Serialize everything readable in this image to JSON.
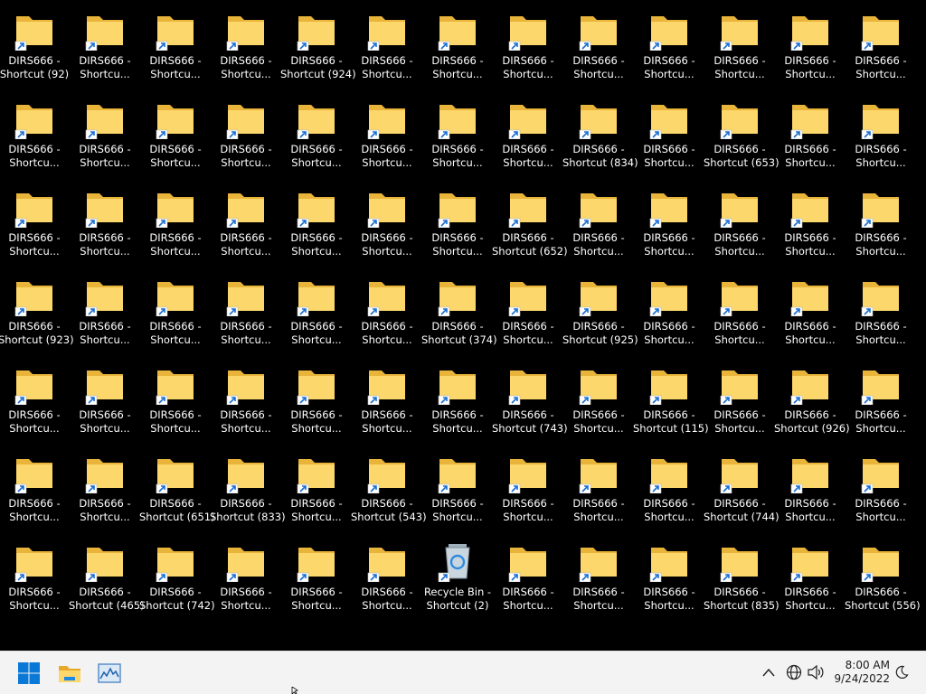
{
  "desktop": {
    "items": [
      [
        "DIRS666 - Shortcut (92)",
        "DIRS666 - Shortcu...",
        "DIRS666 - Shortcu...",
        "DIRS666 - Shortcu...",
        "DIRS666 - Shortcut (924)",
        "DIRS666 - Shortcu...",
        "DIRS666 - Shortcu...",
        "DIRS666 - Shortcu...",
        "DIRS666 - Shortcu...",
        "DIRS666 - Shortcu...",
        "DIRS666 - Shortcu...",
        "DIRS666 - Shortcu...",
        "DIRS666 - Shortcu..."
      ],
      [
        "DIRS666 - Shortcu...",
        "DIRS666 - Shortcu...",
        "DIRS666 - Shortcu...",
        "DIRS666 - Shortcu...",
        "DIRS666 - Shortcu...",
        "DIRS666 - Shortcu...",
        "DIRS666 - Shortcu...",
        "DIRS666 - Shortcu...",
        "DIRS666 - Shortcut (834)",
        "DIRS666 - Shortcu...",
        "DIRS666 - Shortcut (653)",
        "DIRS666 - Shortcu...",
        "DIRS666 - Shortcu..."
      ],
      [
        "DIRS666 - Shortcu...",
        "DIRS666 - Shortcu...",
        "DIRS666 - Shortcu...",
        "DIRS666 - Shortcu...",
        "DIRS666 - Shortcu...",
        "DIRS666 - Shortcu...",
        "DIRS666 - Shortcu...",
        "DIRS666 - Shortcut (652)",
        "DIRS666 - Shortcu...",
        "DIRS666 - Shortcu...",
        "DIRS666 - Shortcu...",
        "DIRS666 - Shortcu...",
        "DIRS666 - Shortcu..."
      ],
      [
        "DIRS666 - Shortcut (923)",
        "DIRS666 - Shortcu...",
        "DIRS666 - Shortcu...",
        "DIRS666 - Shortcu...",
        "DIRS666 - Shortcu...",
        "DIRS666 - Shortcu...",
        "DIRS666 - Shortcut (374)",
        "DIRS666 - Shortcu...",
        "DIRS666 - Shortcut (925)",
        "DIRS666 - Shortcu...",
        "DIRS666 - Shortcu...",
        "DIRS666 - Shortcu...",
        "DIRS666 - Shortcu..."
      ],
      [
        "DIRS666 - Shortcu...",
        "DIRS666 - Shortcu...",
        "DIRS666 - Shortcu...",
        "DIRS666 - Shortcu...",
        "DIRS666 - Shortcu...",
        "DIRS666 - Shortcu...",
        "DIRS666 - Shortcu...",
        "DIRS666 - Shortcut (743)",
        "DIRS666 - Shortcu...",
        "DIRS666 - Shortcut (115)",
        "DIRS666 - Shortcu...",
        "DIRS666 - Shortcut (926)",
        "DIRS666 - Shortcu..."
      ],
      [
        "DIRS666 - Shortcu...",
        "DIRS666 - Shortcu...",
        "DIRS666 - Shortcut (651)",
        "DIRS666 - Shortcut (833)",
        "DIRS666 - Shortcu...",
        "DIRS666 - Shortcut (543)",
        "DIRS666 - Shortcu...",
        "DIRS666 - Shortcu...",
        "DIRS666 - Shortcu...",
        "DIRS666 - Shortcu...",
        "DIRS666 - Shortcut (744)",
        "DIRS666 - Shortcu...",
        "DIRS666 - Shortcu..."
      ],
      [
        "DIRS666 - Shortcu...",
        "DIRS666 - Shortcut (465)",
        "DIRS666 - Shortcut (742)",
        "DIRS666 - Shortcu...",
        "DIRS666 - Shortcu...",
        "DIRS666 - Shortcu...",
        "Recycle Bin - Shortcut (2)",
        "DIRS666 - Shortcu...",
        "DIRS666 - Shortcu...",
        "DIRS666 - Shortcu...",
        "DIRS666 - Shortcut (835)",
        "DIRS666 - Shortcu...",
        "DIRS666 - Shortcut (556)"
      ]
    ],
    "recycle_bin_position": {
      "row": 6,
      "col": 6
    }
  },
  "taskbar": {
    "start_icon": "windows-start-icon",
    "pinned": [
      "file-explorer-icon",
      "task-manager-icon"
    ],
    "tray": [
      "chevron-up-icon",
      "network-globe-icon",
      "volume-icon"
    ],
    "clock_time": "8:00 AM",
    "clock_date": "9/24/2022",
    "night_icon": "moon-icon"
  },
  "colors": {
    "desktop_bg": "#000000",
    "folder_back": "#e8b43a",
    "folder_front": "#fcd76b",
    "shortcut_arrow": "#1a6fd1",
    "taskbar_bg": "#f3f3f3",
    "start_blue": "#0a78d7"
  }
}
